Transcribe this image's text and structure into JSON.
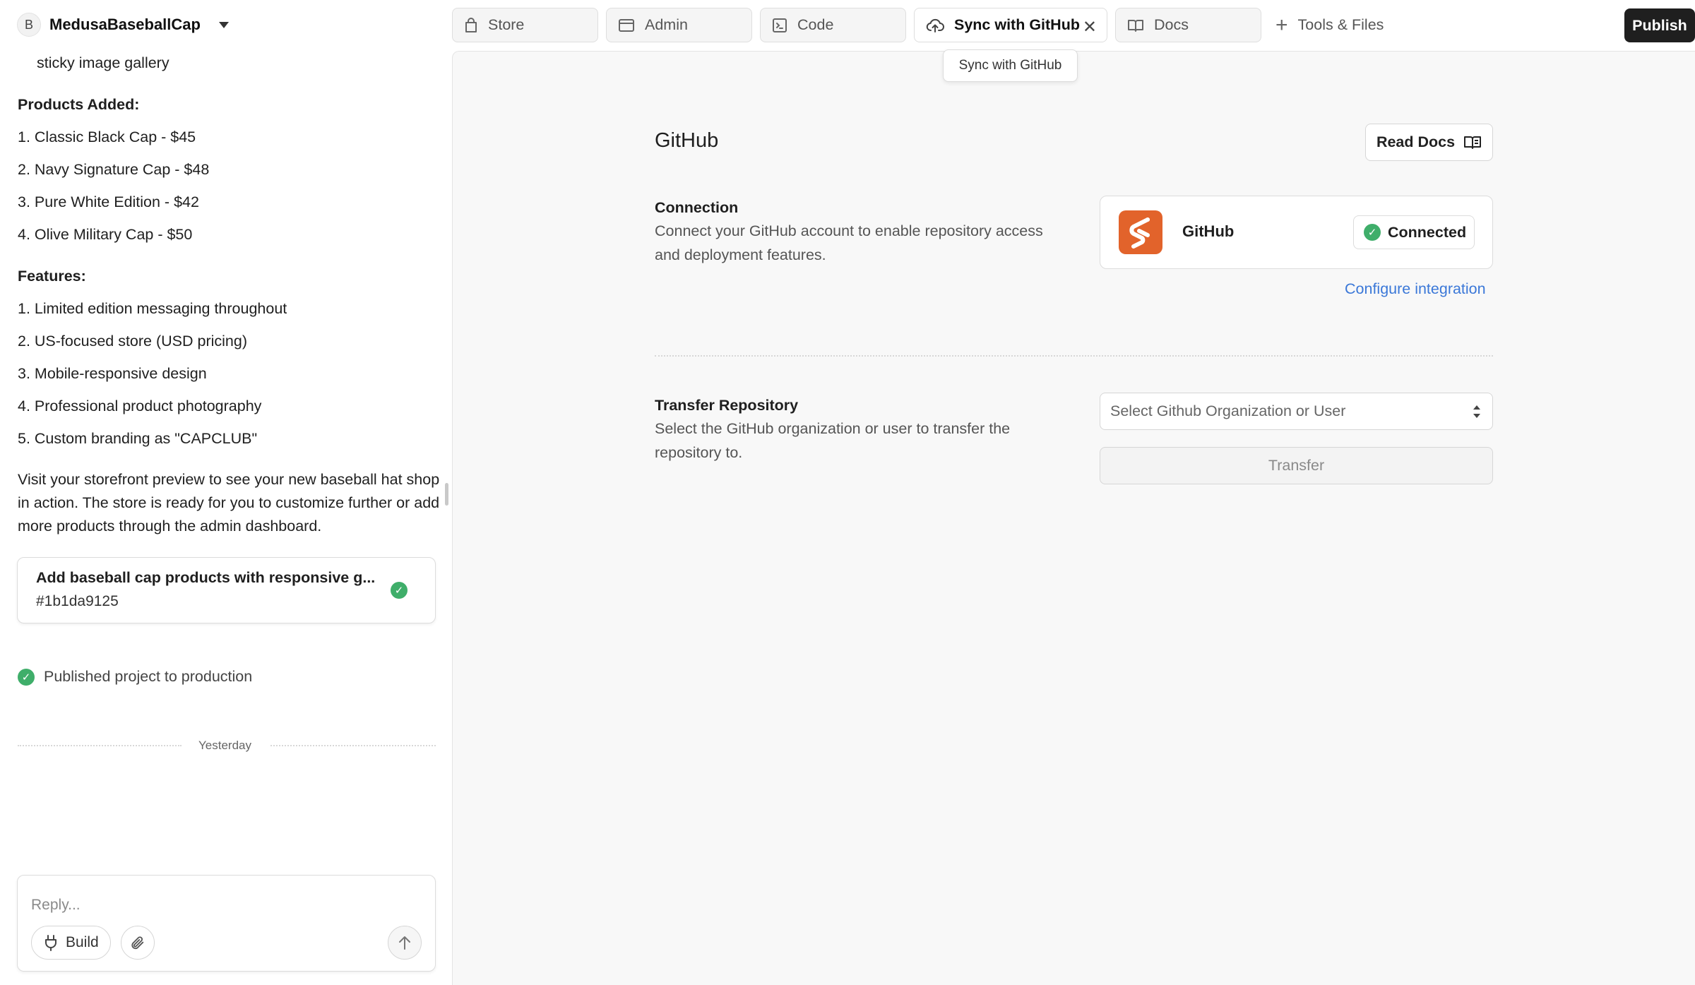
{
  "project": {
    "avatar_letter": "B",
    "name": "MedusaBaseballCap"
  },
  "chat": {
    "intro_item": "sticky image gallery",
    "products_heading": "Products Added:",
    "products": [
      "1. Classic Black Cap - $45",
      "2. Navy Signature Cap - $48",
      "3. Pure White Edition - $42",
      "4. Olive Military Cap - $50"
    ],
    "features_heading": "Features:",
    "features": [
      "1. Limited edition messaging throughout",
      "2. US-focused store (USD pricing)",
      "3. Mobile-responsive design",
      "4. Professional product photography",
      "5. Custom branding as \"CAPCLUB\""
    ],
    "closing": "Visit your storefront preview to see your new baseball hat shop in action. The store is ready for you to customize further or add more products through the admin dashboard.",
    "commit": {
      "title": "Add baseball cap products with responsive g...",
      "hash": "#1b1da9125"
    },
    "published": "Published project to production",
    "divider": "Yesterday"
  },
  "composer": {
    "placeholder": "Reply...",
    "build_label": "Build"
  },
  "tabs": [
    {
      "label": "Store",
      "icon": "bag-icon"
    },
    {
      "label": "Admin",
      "icon": "window-icon"
    },
    {
      "label": "Code",
      "icon": "terminal-icon"
    },
    {
      "label": "Sync with GitHub",
      "icon": "cloud-upload-icon",
      "active": true
    },
    {
      "label": "Docs",
      "icon": "book-icon"
    }
  ],
  "tools_label": "Tools & Files",
  "publish_label": "Publish",
  "tooltip": "Sync with GitHub",
  "github": {
    "title": "GitHub",
    "read_docs": "Read Docs",
    "connection": {
      "title": "Connection",
      "description": "Connect your GitHub account to enable repository access and deployment features.",
      "provider": "GitHub",
      "status": "Connected",
      "configure": "Configure integration"
    },
    "transfer": {
      "title": "Transfer Repository",
      "description": "Select the GitHub organization or user to transfer the repository to.",
      "select_placeholder": "Select Github Organization or User",
      "button": "Transfer"
    }
  },
  "colors": {
    "accent": "#3b78d8",
    "success": "#3fae6a",
    "brand_logo": "#e2632b",
    "publish_bg": "#1f1f1f"
  }
}
